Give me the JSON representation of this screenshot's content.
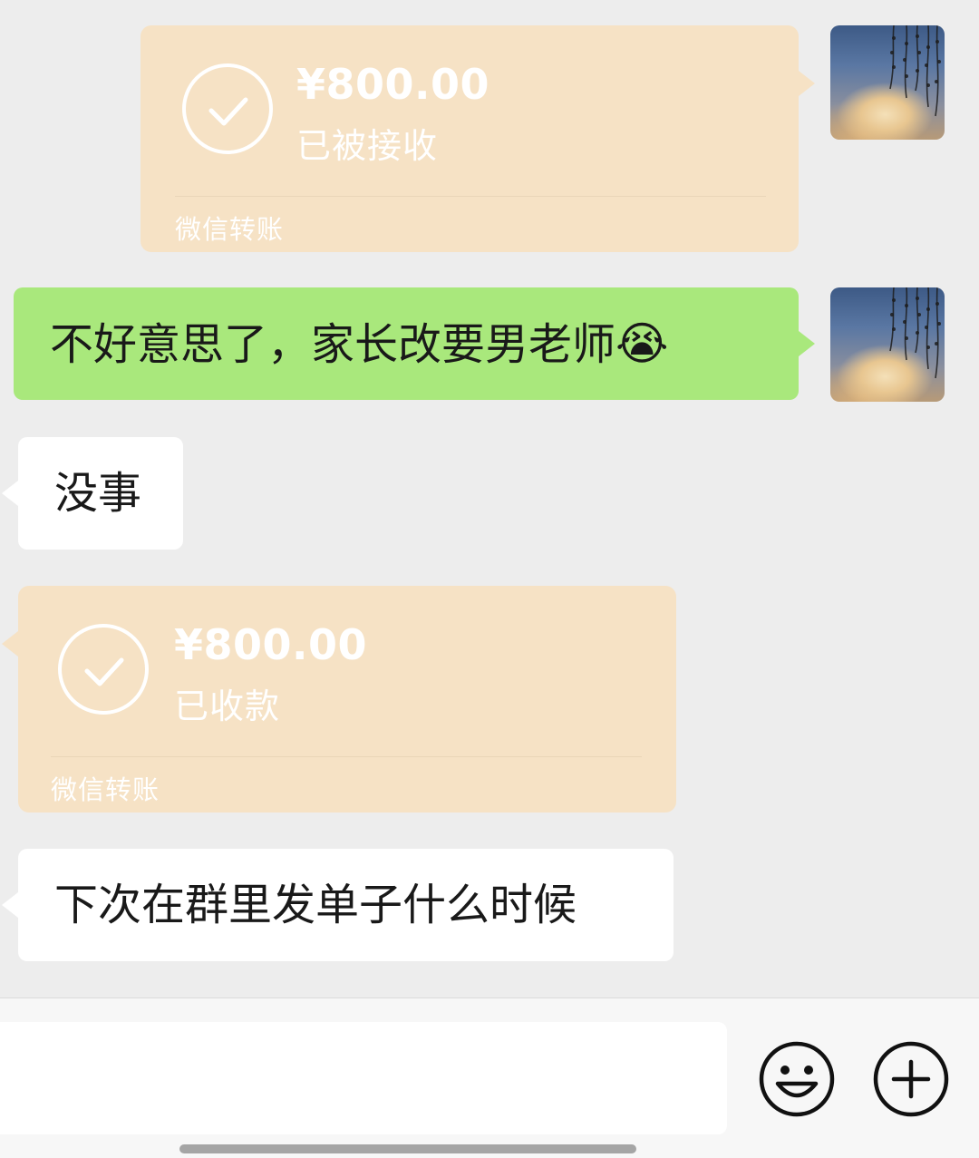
{
  "messages": {
    "transfer_sent": {
      "amount": "¥800.00",
      "status": "已被接收",
      "brand": "微信转账"
    },
    "sent_text": {
      "text": "不好意思了，家长改要男老师",
      "emoji": "😭"
    },
    "received_text_1": {
      "text": "没事"
    },
    "transfer_received": {
      "amount": "¥800.00",
      "status": "已收款",
      "brand": "微信转账"
    },
    "received_text_2": {
      "text": "下次在群里发单子什么时候"
    }
  },
  "input_bar": {
    "placeholder": "",
    "emoji_button_icon": "smiley-face-icon",
    "more_button_icon": "plus-circle-icon"
  },
  "colors": {
    "background": "#ededed",
    "sent_bubble": "#a9e87c",
    "received_bubble": "#ffffff",
    "transfer_card": "#f6e2c5"
  }
}
